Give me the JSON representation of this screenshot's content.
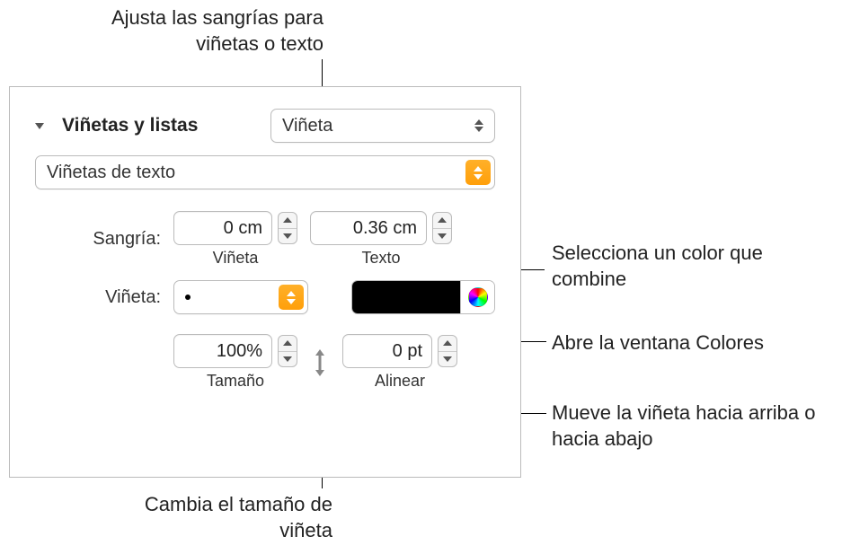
{
  "callouts": {
    "indent": "Ajusta las sangrías para viñetas o texto",
    "color_match": "Selecciona un color que combine",
    "colors_window": "Abre la ventana Colores",
    "align": "Mueve la viñeta hacia arriba o hacia abajo",
    "size": "Cambia el tamaño de viñeta"
  },
  "panel": {
    "section_title": "Viñetas y listas",
    "list_type": "Viñeta",
    "bullet_style": "Viñetas de texto",
    "indent_label": "Sangría:",
    "bullet_indent_value": "0 cm",
    "bullet_indent_caption": "Viñeta",
    "text_indent_value": "0.36 cm",
    "text_indent_caption": "Texto",
    "bullet_char_label": "Viñeta:",
    "size_value": "100%",
    "size_caption": "Tamaño",
    "align_value": "0 pt",
    "align_caption": "Alinear",
    "color_swatch": "#000000"
  },
  "chart_data": null
}
